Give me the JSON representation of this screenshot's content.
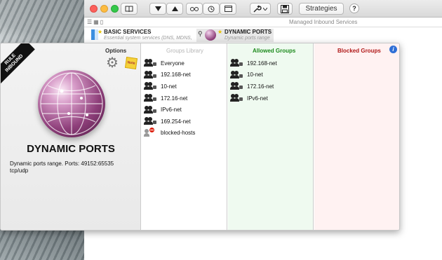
{
  "toolbar": {
    "strategies_label": "Strategies",
    "help_label": "?"
  },
  "subbar": {
    "managed_label": "Managed Inbound Services"
  },
  "tabs": [
    {
      "title": "BASIC SERVICES",
      "subtitle": "Essential system services (DNS, MDNS, ..."
    },
    {
      "title": "DYNAMIC PORTS",
      "subtitle": "Dynamic ports range"
    }
  ],
  "rule": {
    "ribbon_line1": "RULE",
    "ribbon_line2": "INBOUND",
    "options_label": "Options",
    "note_label": "Note",
    "title": "DYNAMIC PORTS",
    "description_line1": "Dynamic ports range. Ports: 49152:65535",
    "description_line2": "tcp/udp"
  },
  "columns": {
    "library": {
      "header": "Groups Library",
      "items": [
        "Everyone",
        "192.168-net",
        "10-net",
        "172.16-net",
        "IPv6-net",
        "169.254-net",
        "blocked-hosts"
      ]
    },
    "allowed": {
      "header": "Allowed Groups",
      "items": [
        "192.168-net",
        "10-net",
        "172.16-net",
        "IPv6-net"
      ]
    },
    "blocked": {
      "header": "Blocked Groups",
      "items": []
    }
  },
  "colors": {
    "allowed_header": "#1c8a1c",
    "blocked_header": "#b01818",
    "allowed_bg": "#effaf0",
    "blocked_bg": "#fff2f2"
  }
}
